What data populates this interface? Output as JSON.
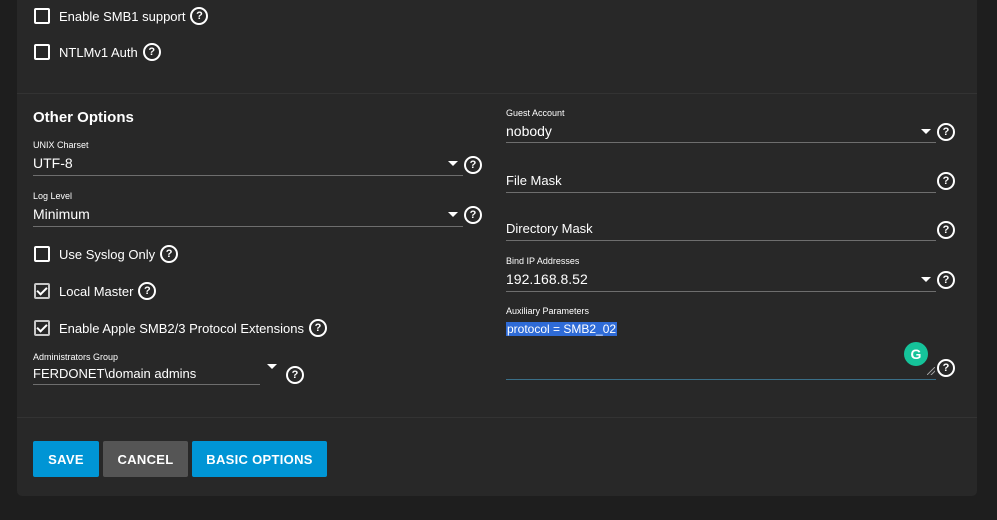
{
  "smb_options": {
    "enable_smb1": {
      "label": "Enable SMB1 support",
      "checked": false
    },
    "ntlmv1_auth": {
      "label": "NTLMv1 Auth",
      "checked": false
    }
  },
  "other_options": {
    "title": "Other Options",
    "unix_charset": {
      "label": "UNIX Charset",
      "value": "UTF-8"
    },
    "log_level": {
      "label": "Log Level",
      "value": "Minimum"
    },
    "use_syslog_only": {
      "label": "Use Syslog Only",
      "checked": false
    },
    "local_master": {
      "label": "Local Master",
      "checked": true
    },
    "apple_extensions": {
      "label": "Enable Apple SMB2/3 Protocol Extensions",
      "checked": true
    },
    "administrators_group": {
      "label": "Administrators Group",
      "value": "FERDONET\\domain admins"
    }
  },
  "right_column": {
    "guest_account": {
      "label": "Guest Account",
      "value": "nobody"
    },
    "file_mask": {
      "placeholder": "File Mask"
    },
    "directory_mask": {
      "placeholder": "Directory Mask"
    },
    "bind_ip": {
      "label": "Bind IP Addresses",
      "value": "192.168.8.52"
    },
    "auxiliary_parameters": {
      "label": "Auxiliary Parameters",
      "value": "protocol = SMB2_02"
    }
  },
  "buttons": {
    "save": "SAVE",
    "cancel": "CANCEL",
    "basic_options": "BASIC OPTIONS"
  },
  "icons": {
    "help": "?",
    "grammarly": "G"
  },
  "colors": {
    "background": "#1e1e1e",
    "card": "#282828",
    "primary": "#0095d5",
    "secondary": "#555555",
    "selection": "#2f6bd6",
    "grammarly": "#15c39a"
  }
}
